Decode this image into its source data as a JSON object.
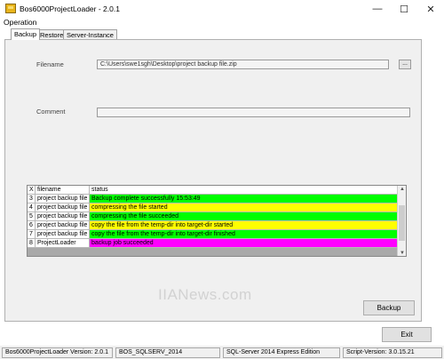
{
  "window": {
    "title": "Bos6000ProjectLoader - 2.0.1",
    "minimize_glyph": "—",
    "maximize_glyph": "☐",
    "close_glyph": "✕",
    "icon": "app-icon"
  },
  "menu": {
    "operation": "Operation"
  },
  "tabs": [
    {
      "label": "Backup",
      "active": true
    },
    {
      "label": "Restore",
      "active": false
    },
    {
      "label": "Server-Instance",
      "active": false
    }
  ],
  "backup": {
    "filename_label": "Filename",
    "filename_value": "C:\\Users\\swe1sgh\\Desktop\\project backup file.zip",
    "browse_label": "...",
    "comment_label": "Comment",
    "comment_value": "",
    "backup_button": "Backup"
  },
  "grid": {
    "columns": [
      "X",
      "filename",
      "status"
    ],
    "rows": [
      {
        "x": "3",
        "filename": "project backup file",
        "status": "Backup complete successfully 15:53:49",
        "color": "#00ff00"
      },
      {
        "x": "4",
        "filename": "project backup file",
        "status": "compressing the file started",
        "color": "#ffff00"
      },
      {
        "x": "5",
        "filename": "project backup file",
        "status": "compressing the file succeeded",
        "color": "#00ff00"
      },
      {
        "x": "6",
        "filename": "project backup file",
        "status": "copy the file from the temp-dir into target-dir started",
        "color": "#ffff00"
      },
      {
        "x": "7",
        "filename": "project backup file",
        "status": "copy the file from the temp-dir into target-dir finished",
        "color": "#00ff00"
      },
      {
        "x": "8",
        "filename": "ProjectLoader",
        "status": "backup job succeeded",
        "color": "#ff00ff"
      }
    ]
  },
  "exit_button": "Exit",
  "watermark": "IIANews.com",
  "status_bar": {
    "version": "Bos6000ProjectLoader Version: 2.0.1",
    "instance": "BOS_SQLSERV_2014",
    "sql_server": "SQL-Server 2014 Express Edition",
    "script_version": "Script-Version: 3.0.15.21"
  }
}
